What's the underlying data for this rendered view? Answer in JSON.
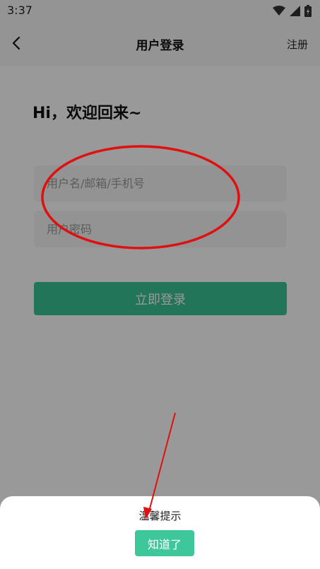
{
  "status_bar": {
    "time": "3:37",
    "icons": [
      "wifi-icon",
      "signal-icon",
      "battery-icon"
    ]
  },
  "nav": {
    "title": "用户登录",
    "right_link": "注册",
    "back_icon": "chevron-left-icon"
  },
  "login": {
    "greeting": "Hi，欢迎回来~",
    "username_placeholder": "用户名/邮箱/手机号",
    "password_placeholder": "用户密码",
    "submit_label": "立即登录"
  },
  "dialog": {
    "title": "温馨提示",
    "confirm_label": "知道了"
  },
  "colors": {
    "accent": "#39c394",
    "annotation": "#e01010"
  }
}
